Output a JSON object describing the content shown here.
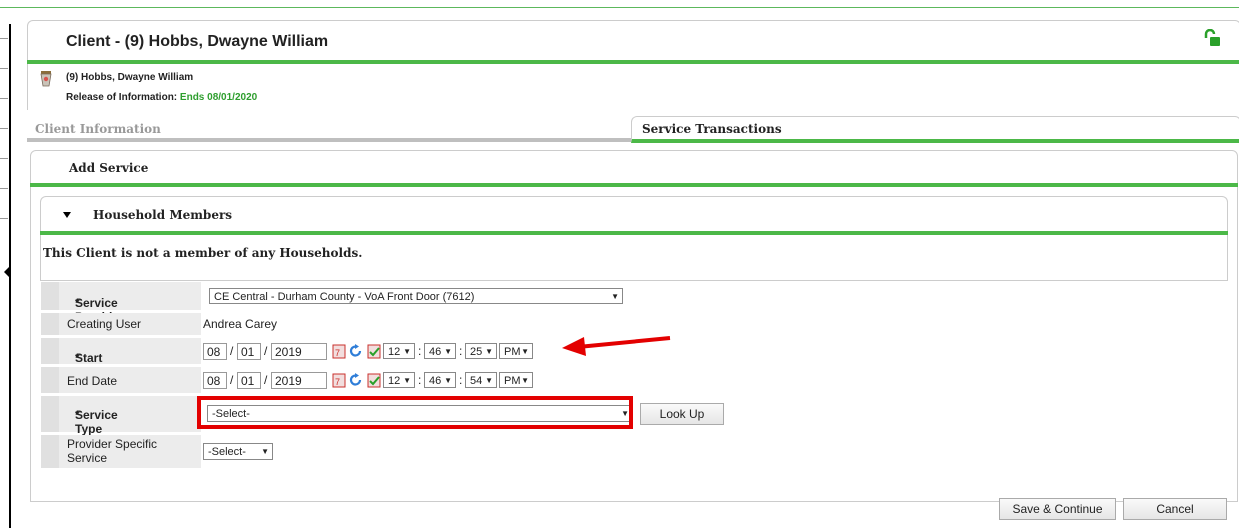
{
  "header": {
    "title": "Client - (9) Hobbs, Dwayne William"
  },
  "client_info": {
    "name": "(9) Hobbs, Dwayne William",
    "roi_label": "Release of Information:",
    "roi_value": "Ends 08/01/2020"
  },
  "tabs": [
    {
      "label": "Client Information",
      "active": false
    },
    {
      "label": "Service Transactions",
      "active": true
    }
  ],
  "panel": {
    "title": "Add Service"
  },
  "household": {
    "title": "Household Members",
    "message": "This Client is not a member of any Households."
  },
  "form": {
    "service_provider": {
      "label": "Service Provider",
      "required": "*",
      "value": "CE Central - Durham County - VoA Front Door (7612)"
    },
    "creating_user": {
      "label": "Creating User",
      "value": "Andrea Carey"
    },
    "start_date": {
      "label": "Start Date",
      "required": "*",
      "month": "08",
      "day": "01",
      "year": "2019",
      "hour": "12",
      "minute": "46",
      "second": "25",
      "ampm": "PM"
    },
    "end_date": {
      "label": "End Date",
      "month": "08",
      "day": "01",
      "year": "2019",
      "hour": "12",
      "minute": "46",
      "second": "54",
      "ampm": "PM"
    },
    "service_type": {
      "label": "Service Type",
      "required": "*",
      "value": "-Select-",
      "lookup_label": "Look Up"
    },
    "provider_specific": {
      "label_line1": "Provider Specific",
      "label_line2": "Service",
      "value": "-Select-"
    }
  },
  "buttons": {
    "save_continue": "Save & Continue",
    "cancel": "Cancel"
  },
  "colors": {
    "accent_green": "#4cb848",
    "highlight_red": "#e30000"
  },
  "icons": {
    "lock": "unlocked-padlock-icon",
    "client": "client-cup-icon",
    "calendar": "calendar-icon",
    "refresh": "refresh-icon",
    "calendar_check": "calendar-check-icon"
  }
}
